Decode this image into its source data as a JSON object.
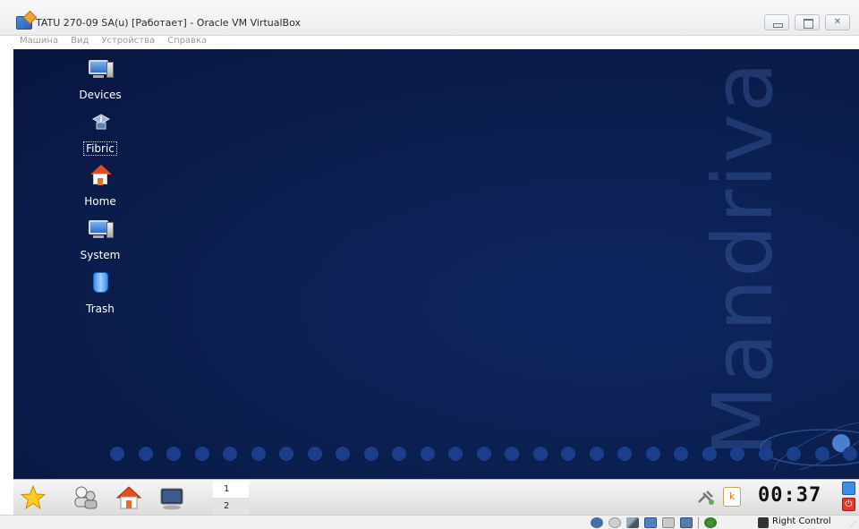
{
  "window": {
    "title": "TATU 270-09 SA(u) [Работает] - Oracle VM VirtualBox",
    "close_glyph": "✕"
  },
  "menu": [
    "Машина",
    "Вид",
    "Устройства",
    "Справка"
  ],
  "desktop": {
    "watermark": "Mandriva",
    "icons": [
      {
        "label": "Devices",
        "icon": "computer-icon"
      },
      {
        "label": "Fibric",
        "icon": "network-icon",
        "selected": true
      },
      {
        "label": "Home",
        "icon": "home-folder-icon"
      },
      {
        "label": "System",
        "icon": "computer-icon"
      },
      {
        "label": "Trash",
        "icon": "trash-icon"
      }
    ]
  },
  "taskbar": {
    "launchers": [
      "star-menu-icon",
      "user-switch-icon",
      "home-icon",
      "terminal-icon"
    ],
    "pager": [
      "1",
      "2"
    ],
    "tray_k": "k",
    "clock": "00:37",
    "power_glyph": "⏻"
  },
  "statusbar": {
    "host_key_label": "Right Control"
  },
  "colors": {
    "desktop_bg": "#0a1d4c",
    "dot": "#1a3e8a",
    "accent": "#3a8ee6"
  }
}
